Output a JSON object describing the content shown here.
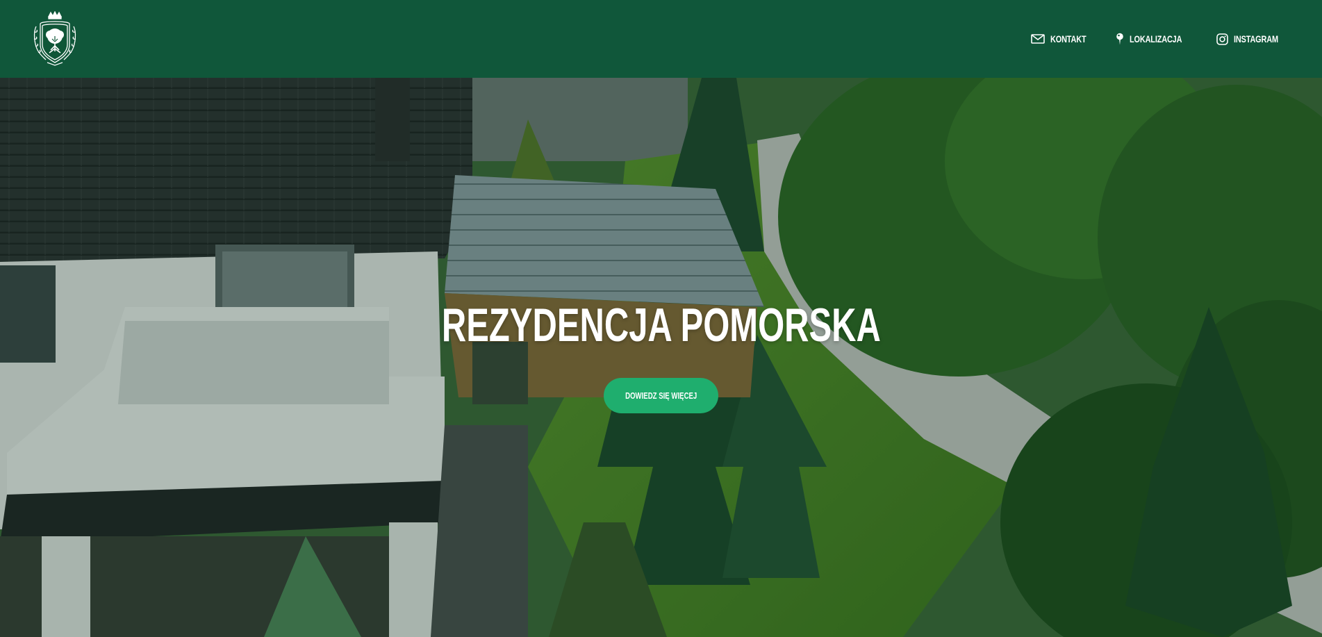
{
  "header": {
    "logo_icon": "tree-crest-logo",
    "nav": [
      {
        "label": "KONTAKT",
        "icon": "envelope-icon"
      },
      {
        "label": "LOKALIZACJA",
        "icon": "map-pin-icon"
      },
      {
        "label": "INSTAGRAM",
        "icon": "instagram-icon"
      }
    ]
  },
  "hero": {
    "title": "REZYDENCJA POMORSKA",
    "cta_label": "DOWIEDZ SIĘ WIĘCEJ"
  },
  "colors": {
    "header_bg": "#10573a",
    "button_bg": "#1fae6e",
    "text": "#ffffff"
  }
}
